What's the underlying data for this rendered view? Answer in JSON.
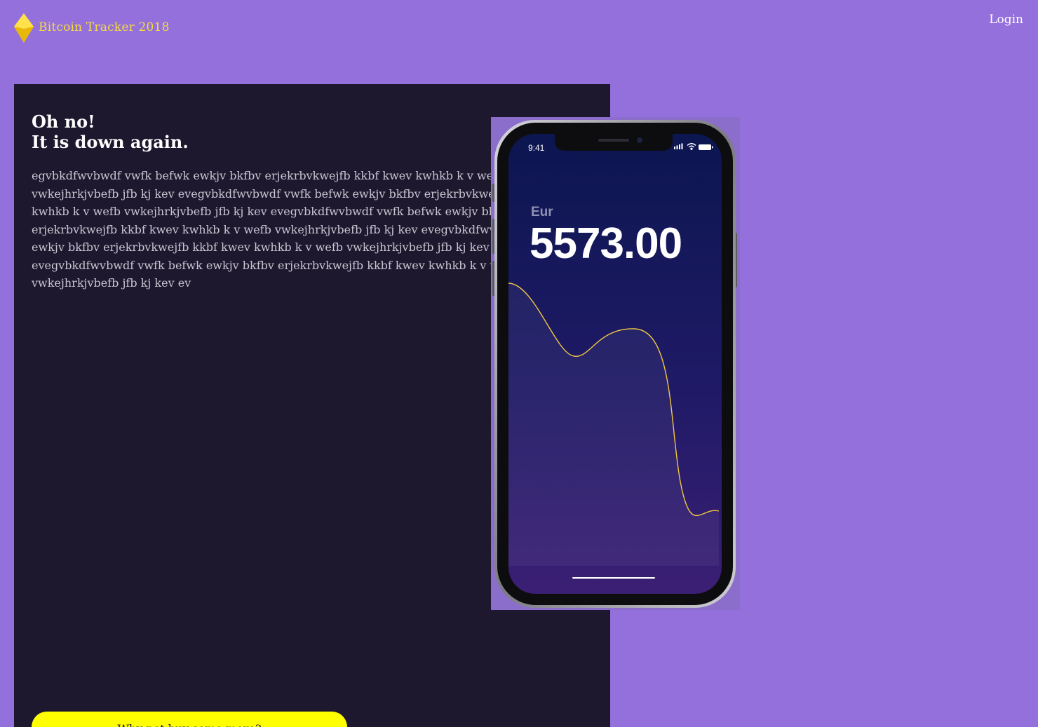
{
  "header": {
    "brand": "Bitcoin Tracker 2018",
    "login_label": "Login",
    "logo_icon": "diamond-logo-icon"
  },
  "hero": {
    "headline_line1": "Oh no!",
    "headline_line2": "It is down again.",
    "paragraph_lines": [
      "egvbkdfwvbwdf vwfk befwk ewkjv bkfbv erjekrbvkwejfb kkbf kwev kwhkb k v wefb",
      "vwkejhrkjvbefb jfb kj kev evegvbkdfwvbwdf vwfk befwk ewkjv bkfbv erjekrbvkwejfb kkbf kwev",
      "kwhkb k v wefb vwkejhrkjvbefb jfb kj kev evegvbkdfwvbwdf vwfk befwk ewkjv bkfbv",
      "erjekrbvkwejfb kkbf kwev kwhkb k v wefb vwkejhrkjvbefb jfb kj kev evegvbkdfwvbwdf vwfk befwk",
      "ewkjv bkfbv erjekrbvkwejfb kkbf kwev kwhkb k v wefb vwkejhrkjvbefb jfb kj kev",
      "evegvbkdfwvbwdf vwfk befwk ewkjv bkfbv erjekrbvkwejfb kkbf kwev kwhkb k v wefb",
      "vwkejhrkjvbefb jfb kj kev ev"
    ],
    "cta_label": "Why not buy some more?"
  },
  "phone": {
    "status_time": "9:41",
    "status_icons": [
      "signal-icon",
      "wifi-icon",
      "battery-icon"
    ],
    "currency_label": "Eur",
    "price": "5573.00"
  },
  "colors": {
    "page_bg": "#9370db",
    "panel_bg": "#1e182e",
    "brand": "#f7dc3b",
    "cta_bg": "#ffff00",
    "chart_line": "#f2c744"
  }
}
